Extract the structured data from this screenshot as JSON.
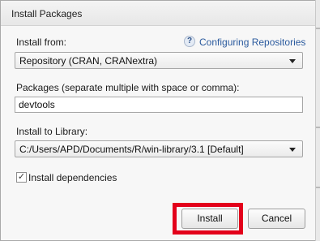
{
  "dialog": {
    "title": "Install Packages",
    "install_from": {
      "label": "Install from:",
      "value": "Repository (CRAN, CRANextra)"
    },
    "help": {
      "icon_glyph": "?",
      "link_text": "Configuring Repositories"
    },
    "packages": {
      "label": "Packages (separate multiple with space or comma):",
      "value": "devtools"
    },
    "library": {
      "label": "Install to Library:",
      "value": "C:/Users/APD/Documents/R/win-library/3.1 [Default]"
    },
    "dependencies": {
      "label": "Install dependencies",
      "checked": true,
      "check_glyph": "✓"
    },
    "buttons": {
      "install": "Install",
      "cancel": "Cancel"
    },
    "highlight_color": "#e3001b",
    "link_color": "#2a5a9e"
  }
}
